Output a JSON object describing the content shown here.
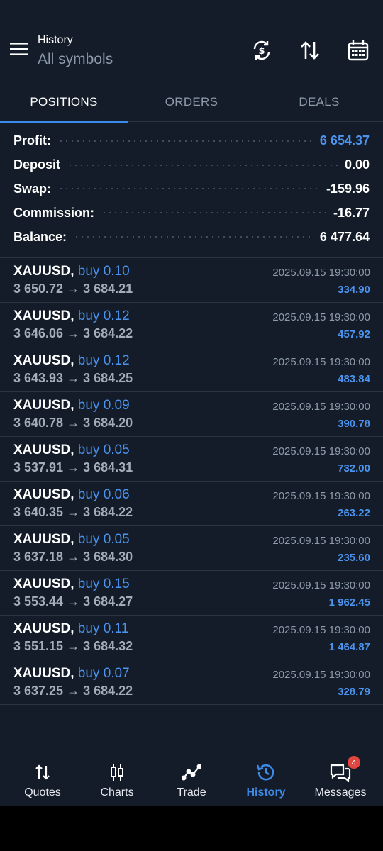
{
  "header": {
    "subtitle": "History",
    "title": "All symbols"
  },
  "tabs": [
    {
      "label": "POSITIONS",
      "active": true
    },
    {
      "label": "ORDERS",
      "active": false
    },
    {
      "label": "DEALS",
      "active": false
    }
  ],
  "summary": [
    {
      "label": "Profit:",
      "value": "6 654.37"
    },
    {
      "label": "Deposit",
      "value": "0.00"
    },
    {
      "label": "Swap:",
      "value": "-159.96"
    },
    {
      "label": "Commission:",
      "value": "-16.77"
    },
    {
      "label": "Balance:",
      "value": "6 477.64"
    }
  ],
  "positions": [
    {
      "symbol": "XAUUSD,",
      "side": "buy 0.10",
      "prices": "3 650.72 → 3 684.21",
      "time": "2025.09.15 19:30:00",
      "profit": "334.90"
    },
    {
      "symbol": "XAUUSD,",
      "side": "buy 0.12",
      "prices": "3 646.06 → 3 684.22",
      "time": "2025.09.15 19:30:00",
      "profit": "457.92"
    },
    {
      "symbol": "XAUUSD,",
      "side": "buy 0.12",
      "prices": "3 643.93 → 3 684.25",
      "time": "2025.09.15 19:30:00",
      "profit": "483.84"
    },
    {
      "symbol": "XAUUSD,",
      "side": "buy 0.09",
      "prices": "3 640.78 → 3 684.20",
      "time": "2025.09.15 19:30:00",
      "profit": "390.78"
    },
    {
      "symbol": "XAUUSD,",
      "side": "buy 0.05",
      "prices": "3 537.91 → 3 684.31",
      "time": "2025.09.15 19:30:00",
      "profit": "732.00"
    },
    {
      "symbol": "XAUUSD,",
      "side": "buy 0.06",
      "prices": "3 640.35 → 3 684.22",
      "time": "2025.09.15 19:30:00",
      "profit": "263.22"
    },
    {
      "symbol": "XAUUSD,",
      "side": "buy 0.05",
      "prices": "3 637.18 → 3 684.30",
      "time": "2025.09.15 19:30:00",
      "profit": "235.60"
    },
    {
      "symbol": "XAUUSD,",
      "side": "buy 0.15",
      "prices": "3 553.44 → 3 684.27",
      "time": "2025.09.15 19:30:00",
      "profit": "1 962.45"
    },
    {
      "symbol": "XAUUSD,",
      "side": "buy 0.11",
      "prices": "3 551.15 → 3 684.32",
      "time": "2025.09.15 19:30:00",
      "profit": "1 464.87"
    },
    {
      "symbol": "XAUUSD,",
      "side": "buy 0.07",
      "prices": "3 637.25 → 3 684.22",
      "time": "2025.09.15 19:30:00",
      "profit": "328.79"
    }
  ],
  "nav": {
    "quotes": "Quotes",
    "charts": "Charts",
    "trade": "Trade",
    "history": "History",
    "messages": "Messages",
    "messages_badge": "4"
  },
  "colors": {
    "background": "#131c28",
    "accent": "#3d8be8",
    "badge": "#e0453f"
  },
  "icons": [
    "menu-icon",
    "currency-exchange-icon",
    "sort-icon",
    "calendar-icon",
    "quotes-icon",
    "charts-icon",
    "trade-icon",
    "history-icon",
    "messages-icon"
  ]
}
